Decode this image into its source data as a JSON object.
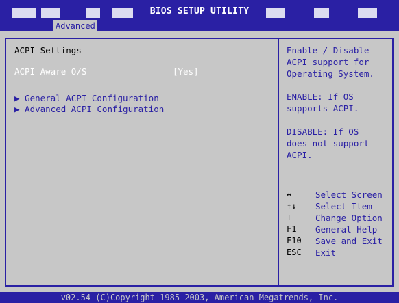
{
  "header": {
    "title": "BIOS SETUP UTILITY",
    "active_tab": "Advanced"
  },
  "main": {
    "section_title": "ACPI Settings",
    "aware_label": "ACPI Aware O/S",
    "aware_value": "[Yes]",
    "menu_items": [
      "▶ General ACPI Configuration",
      "▶ Advanced ACPI Configuration"
    ]
  },
  "help": {
    "lines": [
      "Enable / Disable",
      "ACPI support for",
      "Operating System.",
      "",
      "ENABLE: If OS",
      "supports ACPI.",
      "",
      "DISABLE: If OS",
      "does not support",
      "ACPI."
    ]
  },
  "keys": [
    {
      "key": "↔",
      "desc": "Select Screen"
    },
    {
      "key": "↑↓",
      "desc": "Select Item"
    },
    {
      "key": "+-",
      "desc": "Change Option"
    },
    {
      "key": "F1",
      "desc": "General Help"
    },
    {
      "key": "F10",
      "desc": "Save and Exit"
    },
    {
      "key": "ESC",
      "desc": "Exit"
    }
  ],
  "footer": {
    "text": "v02.54 (C)Copyright 1985-2003, American Megatrends, Inc."
  },
  "colors": {
    "accent_blue": "#2a20a4",
    "background_gray": "#c7c7c7",
    "highlight_white": "#ffffff"
  }
}
